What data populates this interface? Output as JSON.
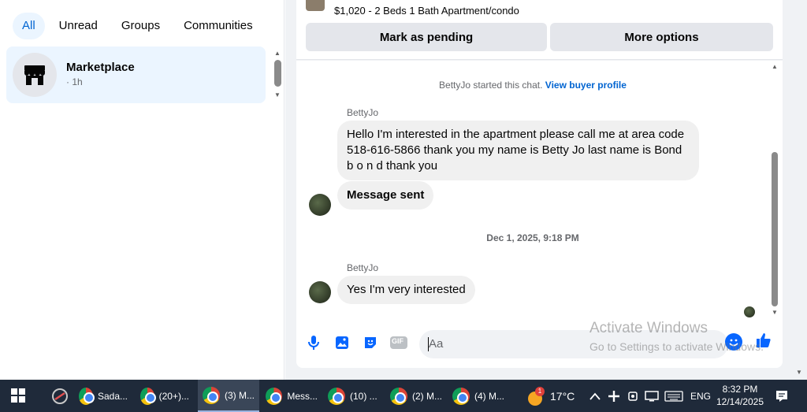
{
  "filters": [
    "All",
    "Unread",
    "Groups",
    "Communities"
  ],
  "chat_list": [
    {
      "name": "Marketplace",
      "meta": "· 1h",
      "icon": "store-icon"
    }
  ],
  "listing": {
    "text": "$1,020 - 2 Beds 1 Bath Apartment/condo",
    "buttons": {
      "pending": "Mark as pending",
      "more": "More options"
    }
  },
  "conversation": {
    "system_line": "BettyJo started this chat.",
    "system_link": "View buyer profile",
    "messages": [
      {
        "sender": "BettyJo",
        "text": "Hello I'm interested in the apartment please call me at area code 518-616-5866 thank you my name is Betty Jo last name is Bond b o n d thank you"
      },
      {
        "sender": "",
        "text": "Message sent"
      },
      {
        "sender": "BettyJo",
        "text": "Yes I'm very interested"
      }
    ],
    "date_divider": "Dec 1, 2025, 9:18 PM"
  },
  "composer": {
    "placeholder": "Aa",
    "icons": [
      "microphone-icon",
      "photo-icon",
      "sticker-icon",
      "gif-icon",
      "emoji-icon",
      "like-icon"
    ],
    "gif_label": "GIF"
  },
  "watermark": {
    "line1": "Activate Windows",
    "line2": "Go to Settings to activate Windows."
  },
  "taskbar": {
    "items": [
      "Sada...",
      "(20+)...",
      "(3) M...",
      "Mess...",
      "(10) ...",
      "(2) M...",
      "(4) M..."
    ],
    "weather": "17°C",
    "language": "ENG",
    "time": "8:32 PM",
    "date": "12/14/2025",
    "weather_badge": "1"
  },
  "colors": {
    "accent": "#0064d1",
    "chip_bg": "#ebf5ff",
    "bubble": "#f0f0f0",
    "taskbar": "#1f2a3a"
  }
}
